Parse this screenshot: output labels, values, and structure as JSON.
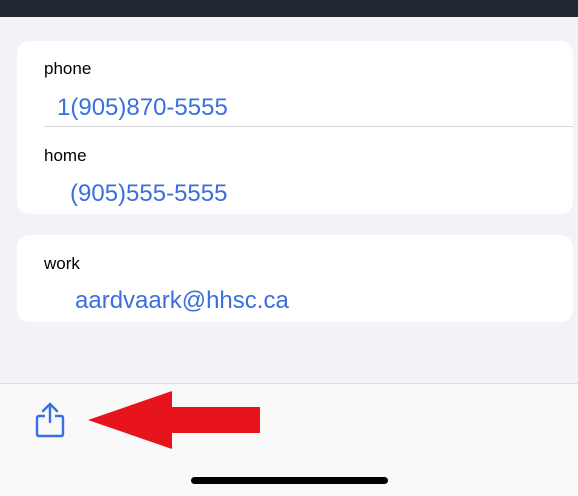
{
  "contact_fields": [
    {
      "label": "phone",
      "value": "1(905)870-5555"
    },
    {
      "label": "home",
      "value": "(905)555-5555"
    }
  ],
  "email_field": {
    "label": "work",
    "value": "aardvaark@hhsc.ca"
  },
  "toolbar": {
    "share_icon": "share-icon"
  },
  "annotation": {
    "arrow_color": "#e8141b"
  },
  "colors": {
    "link_blue": "#3a6fe0",
    "top_bar": "#222833",
    "background": "#f2f2f7"
  }
}
